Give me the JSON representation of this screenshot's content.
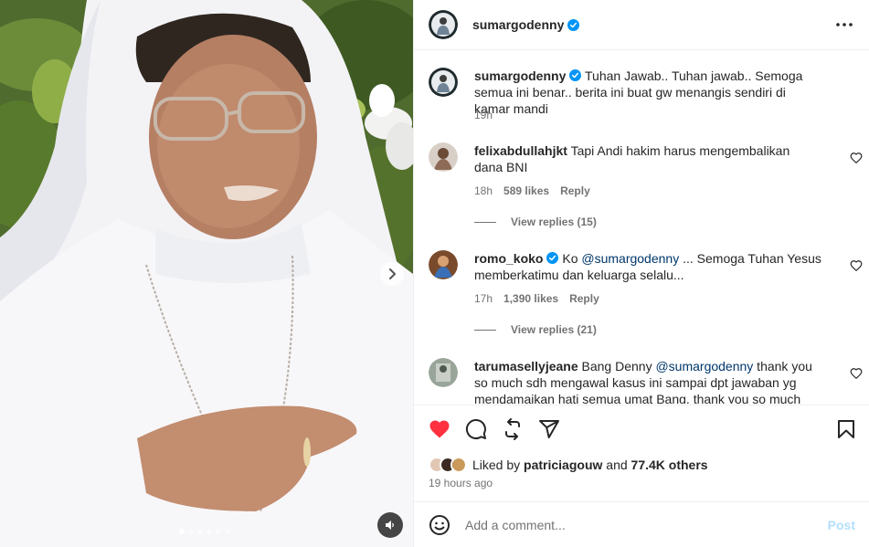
{
  "header": {
    "username": "sumargodenny",
    "verified": true,
    "more_icon": "more-horizontal-icon"
  },
  "caption": {
    "username": "sumargodenny",
    "verified": true,
    "text": "Tuhan Jawab.. Tuhan jawab.. Semoga semua ini benar.. berita ini buat gw menangis sendiri di kamar mandi",
    "time": "19h"
  },
  "comments": [
    {
      "username": "felixabdullahjkt",
      "verified": false,
      "text": "Tapi Andi hakim harus mengembalikan dana BNI",
      "time": "18h",
      "likes": "589 likes",
      "reply": "Reply",
      "view_replies": "View replies (15)"
    },
    {
      "username": "romo_koko",
      "verified": true,
      "text_before": "Ko ",
      "mention": "@sumargodenny",
      "text_after": " ... Semoga Tuhan Yesus memberkatimu dan keluarga selalu...",
      "time": "17h",
      "likes": "1,390 likes",
      "reply": "Reply",
      "view_replies": "View replies (21)"
    },
    {
      "username": "tarumasellyjeane",
      "verified": false,
      "text_before": "Bang Denny ",
      "mention": "@sumargodenny",
      "text_after": " thank you so much sdh mengawal kasus ini sampai dpt jawaban yg mendamaikan hati semua umat Bang, thank you so much"
    }
  ],
  "actions": {
    "icons": [
      "heart-filled-icon",
      "comment-icon",
      "repost-icon",
      "share-icon",
      "bookmark-icon"
    ],
    "liked_by_prefix": "Liked by",
    "liked_by_user": "patriciagouw",
    "liked_by_and": "and",
    "liked_by_others": "77.4K others",
    "time_ago": "19 hours ago",
    "heart_color": "#ff3040"
  },
  "add_comment": {
    "placeholder": "Add a comment...",
    "post_label": "Post",
    "emoji_icon": "emoji-icon"
  },
  "media": {
    "carousel_index": 1,
    "carousel_total": 6,
    "next_icon": "chevron-right-icon",
    "mute_icon": "speaker-icon"
  }
}
